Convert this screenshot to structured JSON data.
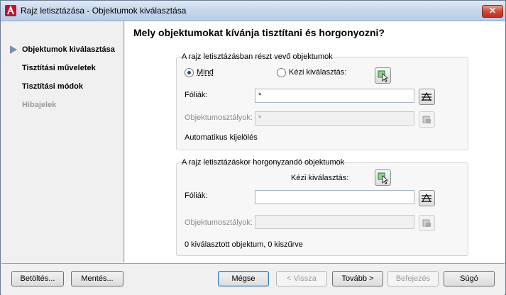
{
  "window": {
    "title": "Rajz letisztázása - Objektumok kiválasztása",
    "close_label": "✕"
  },
  "sidebar": {
    "items": [
      {
        "label": "Objektumok kiválasztása",
        "active": true
      },
      {
        "label": "Tisztítási műveletek"
      },
      {
        "label": "Tisztítási módok"
      },
      {
        "label": "Hibajelek",
        "disabled": true
      }
    ]
  },
  "main": {
    "heading": "Mely objektumokat kívánja tisztítani és horgonyozni?",
    "clean_group": {
      "title": "A rajz letisztázásban részt vevő objektumok",
      "radio_all": "Mind",
      "radio_manual": "Kézi kiválasztás:",
      "selected": "Mind",
      "layers_label": "Fóliák:",
      "layers_value": "*",
      "classes_label": "Objektumosztályok:",
      "classes_value": "*",
      "status": "Automatikus kijelölés"
    },
    "anchor_group": {
      "title": "A rajz letisztázáskor horgonyzandó objektumok",
      "manual_label": "Kézi kiválasztás:",
      "layers_label": "Fóliák:",
      "layers_value": "",
      "classes_label": "Objektumosztályok:",
      "classes_value": "",
      "status": "0 kiválasztott objektum, 0 kiszűrve"
    }
  },
  "footer": {
    "load": "Betöltés...",
    "save": "Mentés...",
    "cancel": "Mégse",
    "back": "< Vissza",
    "next": "Tovább >",
    "finish": "Befejezés",
    "help": "Súgó"
  },
  "icons": {
    "app": "autocad-a-icon",
    "select": "select-objects-icon",
    "layers": "layer-list-icon",
    "classes": "class-list-icon"
  }
}
